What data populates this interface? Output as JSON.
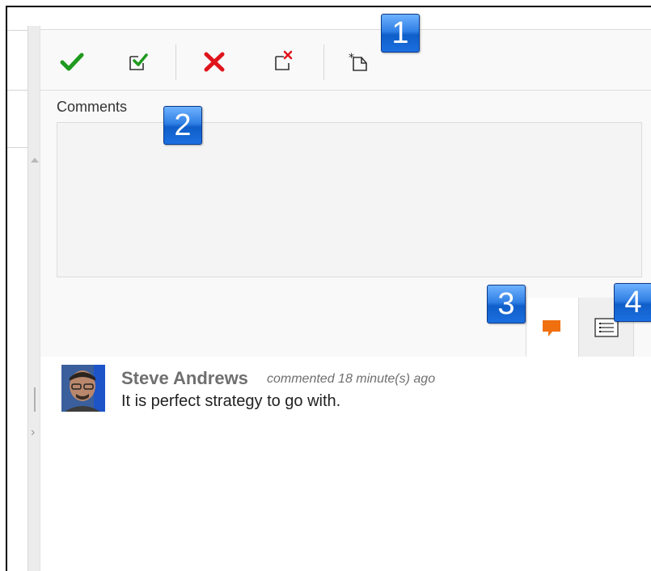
{
  "comments": {
    "label": "Comments",
    "value": "",
    "placeholder": ""
  },
  "callouts": [
    "1",
    "2",
    "3",
    "4"
  ],
  "toolbar": {
    "buttons": [
      "approve-icon",
      "approve-check-icon",
      "reject-icon",
      "reject-check-icon",
      "new-note-icon"
    ]
  },
  "tabs": [
    {
      "icon": "comment-bubble-icon",
      "selected": true
    },
    {
      "icon": "details-list-icon",
      "selected": false
    }
  ],
  "feed": [
    {
      "author": "Steve Andrews",
      "action": "commented 18 minute(s) ago",
      "text": "It is perfect strategy to go with."
    }
  ],
  "colors": {
    "approve": "#1f9a1f",
    "reject": "#e0141c",
    "comment_tab": "#f07010",
    "badge": "#2f7fe4"
  }
}
